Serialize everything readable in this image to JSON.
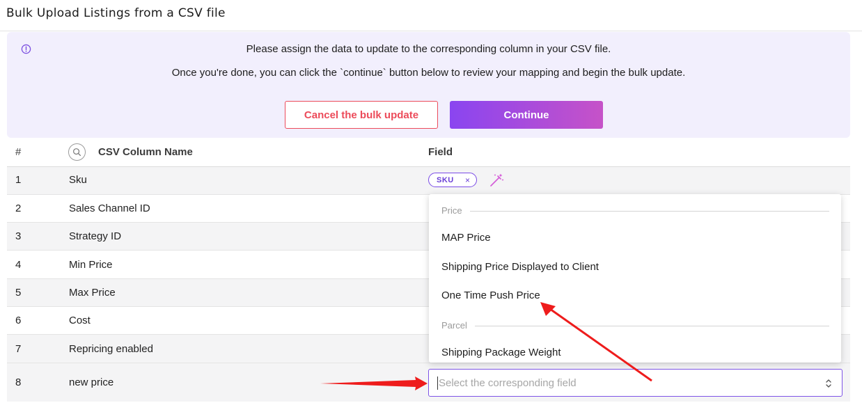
{
  "header": {
    "title": "Bulk Upload Listings from a CSV file"
  },
  "info": {
    "line1": "Please assign the data to update to the corresponding column in your CSV file.",
    "line2": "Once you're done, you can click the `continue` button below to review your mapping and begin the bulk update.",
    "cancel_label": "Cancel the bulk update",
    "continue_label": "Continue"
  },
  "table": {
    "headers": {
      "index": "#",
      "name": "CSV Column Name",
      "field": "Field"
    },
    "rows": [
      {
        "num": "1",
        "name": "Sku"
      },
      {
        "num": "2",
        "name": "Sales Channel ID"
      },
      {
        "num": "3",
        "name": "Strategy ID"
      },
      {
        "num": "4",
        "name": "Min Price"
      },
      {
        "num": "5",
        "name": "Max Price"
      },
      {
        "num": "6",
        "name": "Cost"
      },
      {
        "num": "7",
        "name": "Repricing enabled"
      },
      {
        "num": "8",
        "name": "new price"
      }
    ],
    "sku_chip": {
      "label": "SKU",
      "remove": "×"
    }
  },
  "dropdown": {
    "groups": [
      {
        "label": "Price",
        "options": [
          "MAP Price",
          "Shipping Price Displayed to Client",
          "One Time Push Price"
        ]
      },
      {
        "label": "Parcel",
        "options": [
          "Shipping Package Weight"
        ]
      }
    ]
  },
  "select": {
    "placeholder": "Select the corresponding field"
  },
  "colors": {
    "accent": "#7e54e6",
    "danger": "#ec4b5a",
    "panel_bg": "#f2effd",
    "annotation_arrow": "#ee1c1c"
  },
  "icons": [
    "info-icon",
    "search-icon",
    "magic-wand-icon",
    "chevron-updown-icon"
  ]
}
